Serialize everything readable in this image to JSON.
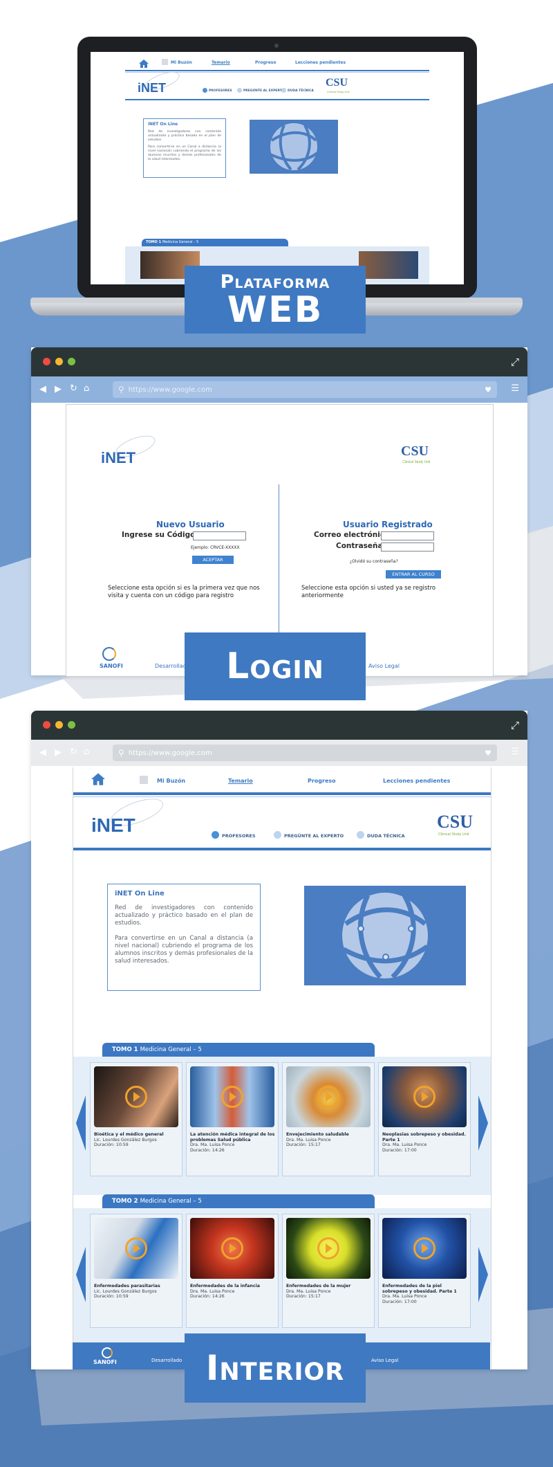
{
  "site": {
    "nav": {
      "mailbox": "Mi Buzón",
      "syllabus": "Temario",
      "progress": "Progreso",
      "pending": "Lecciones pendientes"
    },
    "logo": "iNET",
    "csu": {
      "name": "CSU",
      "sub": "Clinical Study Unit"
    },
    "menu": {
      "profesores": "PROFESORES",
      "pregunte": "PREGÚNTE AL EXPERTO",
      "duda": "DUDA TÉCNICA"
    },
    "info": {
      "title": "iNET On Line",
      "p1": "Red de investigadores con contenido actualizado y práctico basado en el plan de estudios.",
      "p2": "Para convertirse en un  Canal a distancia (a nivel nacional) cubriendo el programa de los alumnos inscritos y demás profesionales de la salud interesados."
    },
    "laptop_info": {
      "p2": "Para convertirse en un  Canal a distancia (a nivel nacional) cubriendo el programa de los alumnos inscritos y demás profesionales de la salud interesados."
    },
    "tomo1": {
      "label": "TOMO 1",
      "sub": "Medicina General – 5"
    },
    "tomo2": {
      "label": "TOMO 2",
      "sub": "Medicina General – 5"
    }
  },
  "labels": {
    "web_top": "Plataforma",
    "web_bottom": "WEB",
    "login": "Login",
    "interior": "Interior"
  },
  "browser": {
    "url_placeholder": "https://www.google.com"
  },
  "login": {
    "new_title": "Nuevo Usuario",
    "code_label": "Ingrese su Código:",
    "example": "Ejemplo: CRVCE-XXXXX",
    "accept": "ACEPTAR",
    "new_desc": "Seleccione esta opción si es la primera vez que nos visita y cuenta con un código para registro",
    "reg_title": "Usuario Registrado",
    "email_label": "Correo electrónico:",
    "pass_label": "Contraseña:",
    "forgot": "¿Olvidó su contraseña?",
    "enter": "ENTRAR AL CURSO",
    "reg_desc": "Seleccione esta opción si usted ya se registro anteriormente",
    "sanofi": "SANOFI",
    "dev": "Desarrollado",
    "legal": "Aviso Legal"
  },
  "interior_footer": {
    "sanofi": "SANOFI",
    "dev": "Desarrollado",
    "legal": "Aviso Legal"
  },
  "courses1": [
    {
      "title": "Bioética y el médico general",
      "author": "Lic. Lourdes González Burgos",
      "duration": "Duración: 10:59"
    },
    {
      "title": "La atención médica integral de los problemas Salud pública",
      "author": "Dra. Ma. Luisa Ponce",
      "duration": "Duración: 14:26"
    },
    {
      "title": "Envejecimiento saludable",
      "author": "Dra. Ma. Luisa Ponce",
      "duration": "Duración: 15:17"
    },
    {
      "title": "Neoplasias sobrepeso y obesidad. Parte 1",
      "author": "Dra. Ma. Luisa Ponce",
      "duration": "Duración: 17:00"
    }
  ],
  "courses2": [
    {
      "title": "Enfermedades parasitarias",
      "author": "Lic. Lourdes González Burgos",
      "duration": "Duración: 10:59"
    },
    {
      "title": "Enfermedades de la infancia",
      "author": "Dra. Ma. Luisa Ponce",
      "duration": "Duración: 14:26"
    },
    {
      "title": "Enfermedades de la mujer",
      "author": "Dra. Ma. Luisa Ponce",
      "duration": "Duración: 15:17"
    },
    {
      "title": "Enfermedades de la piel sobrepeso y obesidad. Parte 1",
      "author": "Dra. Ma. Luisa Ponce",
      "duration": "Duración: 17:00"
    }
  ],
  "colors": {
    "brand_blue": "#3f79c1",
    "accent_orange": "#f0a32a",
    "titlebar": "#2c3536"
  }
}
